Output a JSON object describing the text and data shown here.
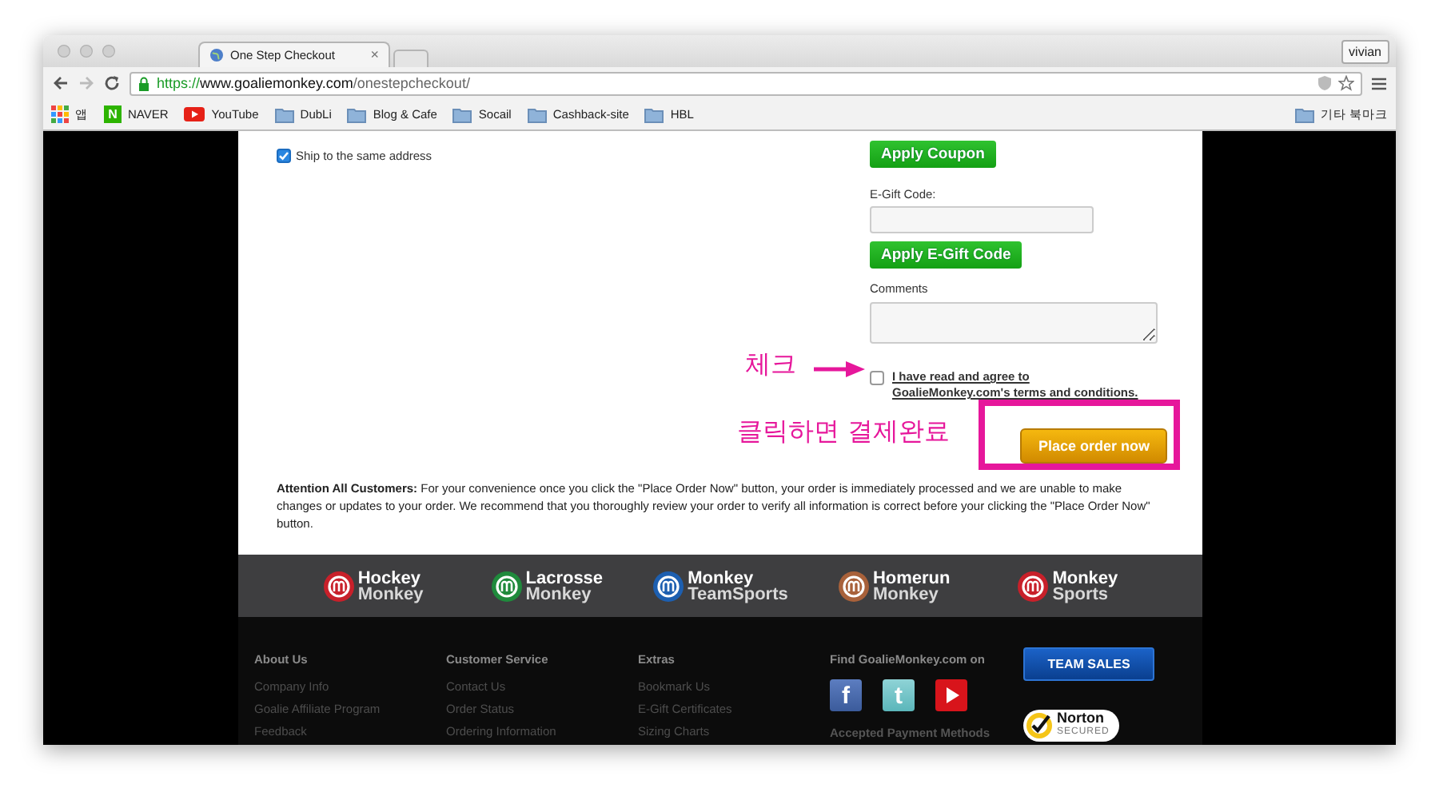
{
  "browser": {
    "tab_title": "One Step Checkout",
    "tab_close": "×",
    "user": "vivian",
    "url_scheme": "https://",
    "url_host": "www.goaliemonkey.com",
    "url_path": "/onestepcheckout/",
    "bookmarks": [
      {
        "kind": "apps",
        "label": "앱"
      },
      {
        "kind": "naver",
        "label": "NAVER",
        "glyph": "N"
      },
      {
        "kind": "youtube",
        "label": "YouTube"
      },
      {
        "kind": "folder",
        "label": "DubLi"
      },
      {
        "kind": "folder",
        "label": "Blog & Cafe"
      },
      {
        "kind": "folder",
        "label": "Socail"
      },
      {
        "kind": "folder",
        "label": "Cashback-site"
      },
      {
        "kind": "folder",
        "label": "HBL"
      }
    ],
    "other_bookmarks": "기타 북마크"
  },
  "checkout": {
    "ship_same": {
      "label": "Ship to the same address",
      "checked": true
    },
    "apply_coupon": "Apply Coupon",
    "egift_label": "E-Gift Code:",
    "apply_egift": "Apply E-Gift Code",
    "comments_label": "Comments",
    "agree": {
      "line1": "I have read and agree to",
      "line2": "GoalieMonkey.com's terms and conditions.",
      "checked": false
    },
    "place_order": "Place order now",
    "notice": "**Attention All Customers:** For your convenience once you click the \"Place Order Now\" button, your order is immediately processed and we are unable to make changes or updates to your order. We recommend that you thoroughly review your order to verify all information is correct before your clicking the \"Place Order Now\" button."
  },
  "annotations": {
    "check_label": "체크",
    "click_label": "클릭하면 결제완료"
  },
  "brands": [
    {
      "line1": "Hockey",
      "line2": "Monkey",
      "color": "#c8202a"
    },
    {
      "line1": "Lacrosse",
      "line2": "Monkey",
      "color": "#1f8a3c"
    },
    {
      "line1": "Monkey",
      "line2": "TeamSports",
      "color": "#1d5fb0"
    },
    {
      "line1": "Homerun",
      "line2": "Monkey",
      "color": "#a8613a"
    },
    {
      "line1": "Monkey",
      "line2": "Sports",
      "color": "#c8202a"
    }
  ],
  "footer": {
    "columns": [
      {
        "title": "About Us",
        "links": [
          "Company Info",
          "Goalie Affiliate Program",
          "Feedback"
        ]
      },
      {
        "title": "Customer Service",
        "links": [
          "Contact Us",
          "Order Status",
          "Ordering Information"
        ]
      },
      {
        "title": "Extras",
        "links": [
          "Bookmark Us",
          "E-Gift Certificates",
          "Sizing Charts"
        ]
      }
    ],
    "social_title": "Find GoalieMonkey.com on",
    "social": [
      {
        "kind": "facebook",
        "glyph": "f"
      },
      {
        "kind": "twitter",
        "glyph": "t"
      },
      {
        "kind": "youtube"
      }
    ],
    "payment_title": "Accepted Payment Methods",
    "team_sales": "TEAM SALES",
    "norton": {
      "name": "Norton",
      "secured": "SECURED"
    }
  }
}
